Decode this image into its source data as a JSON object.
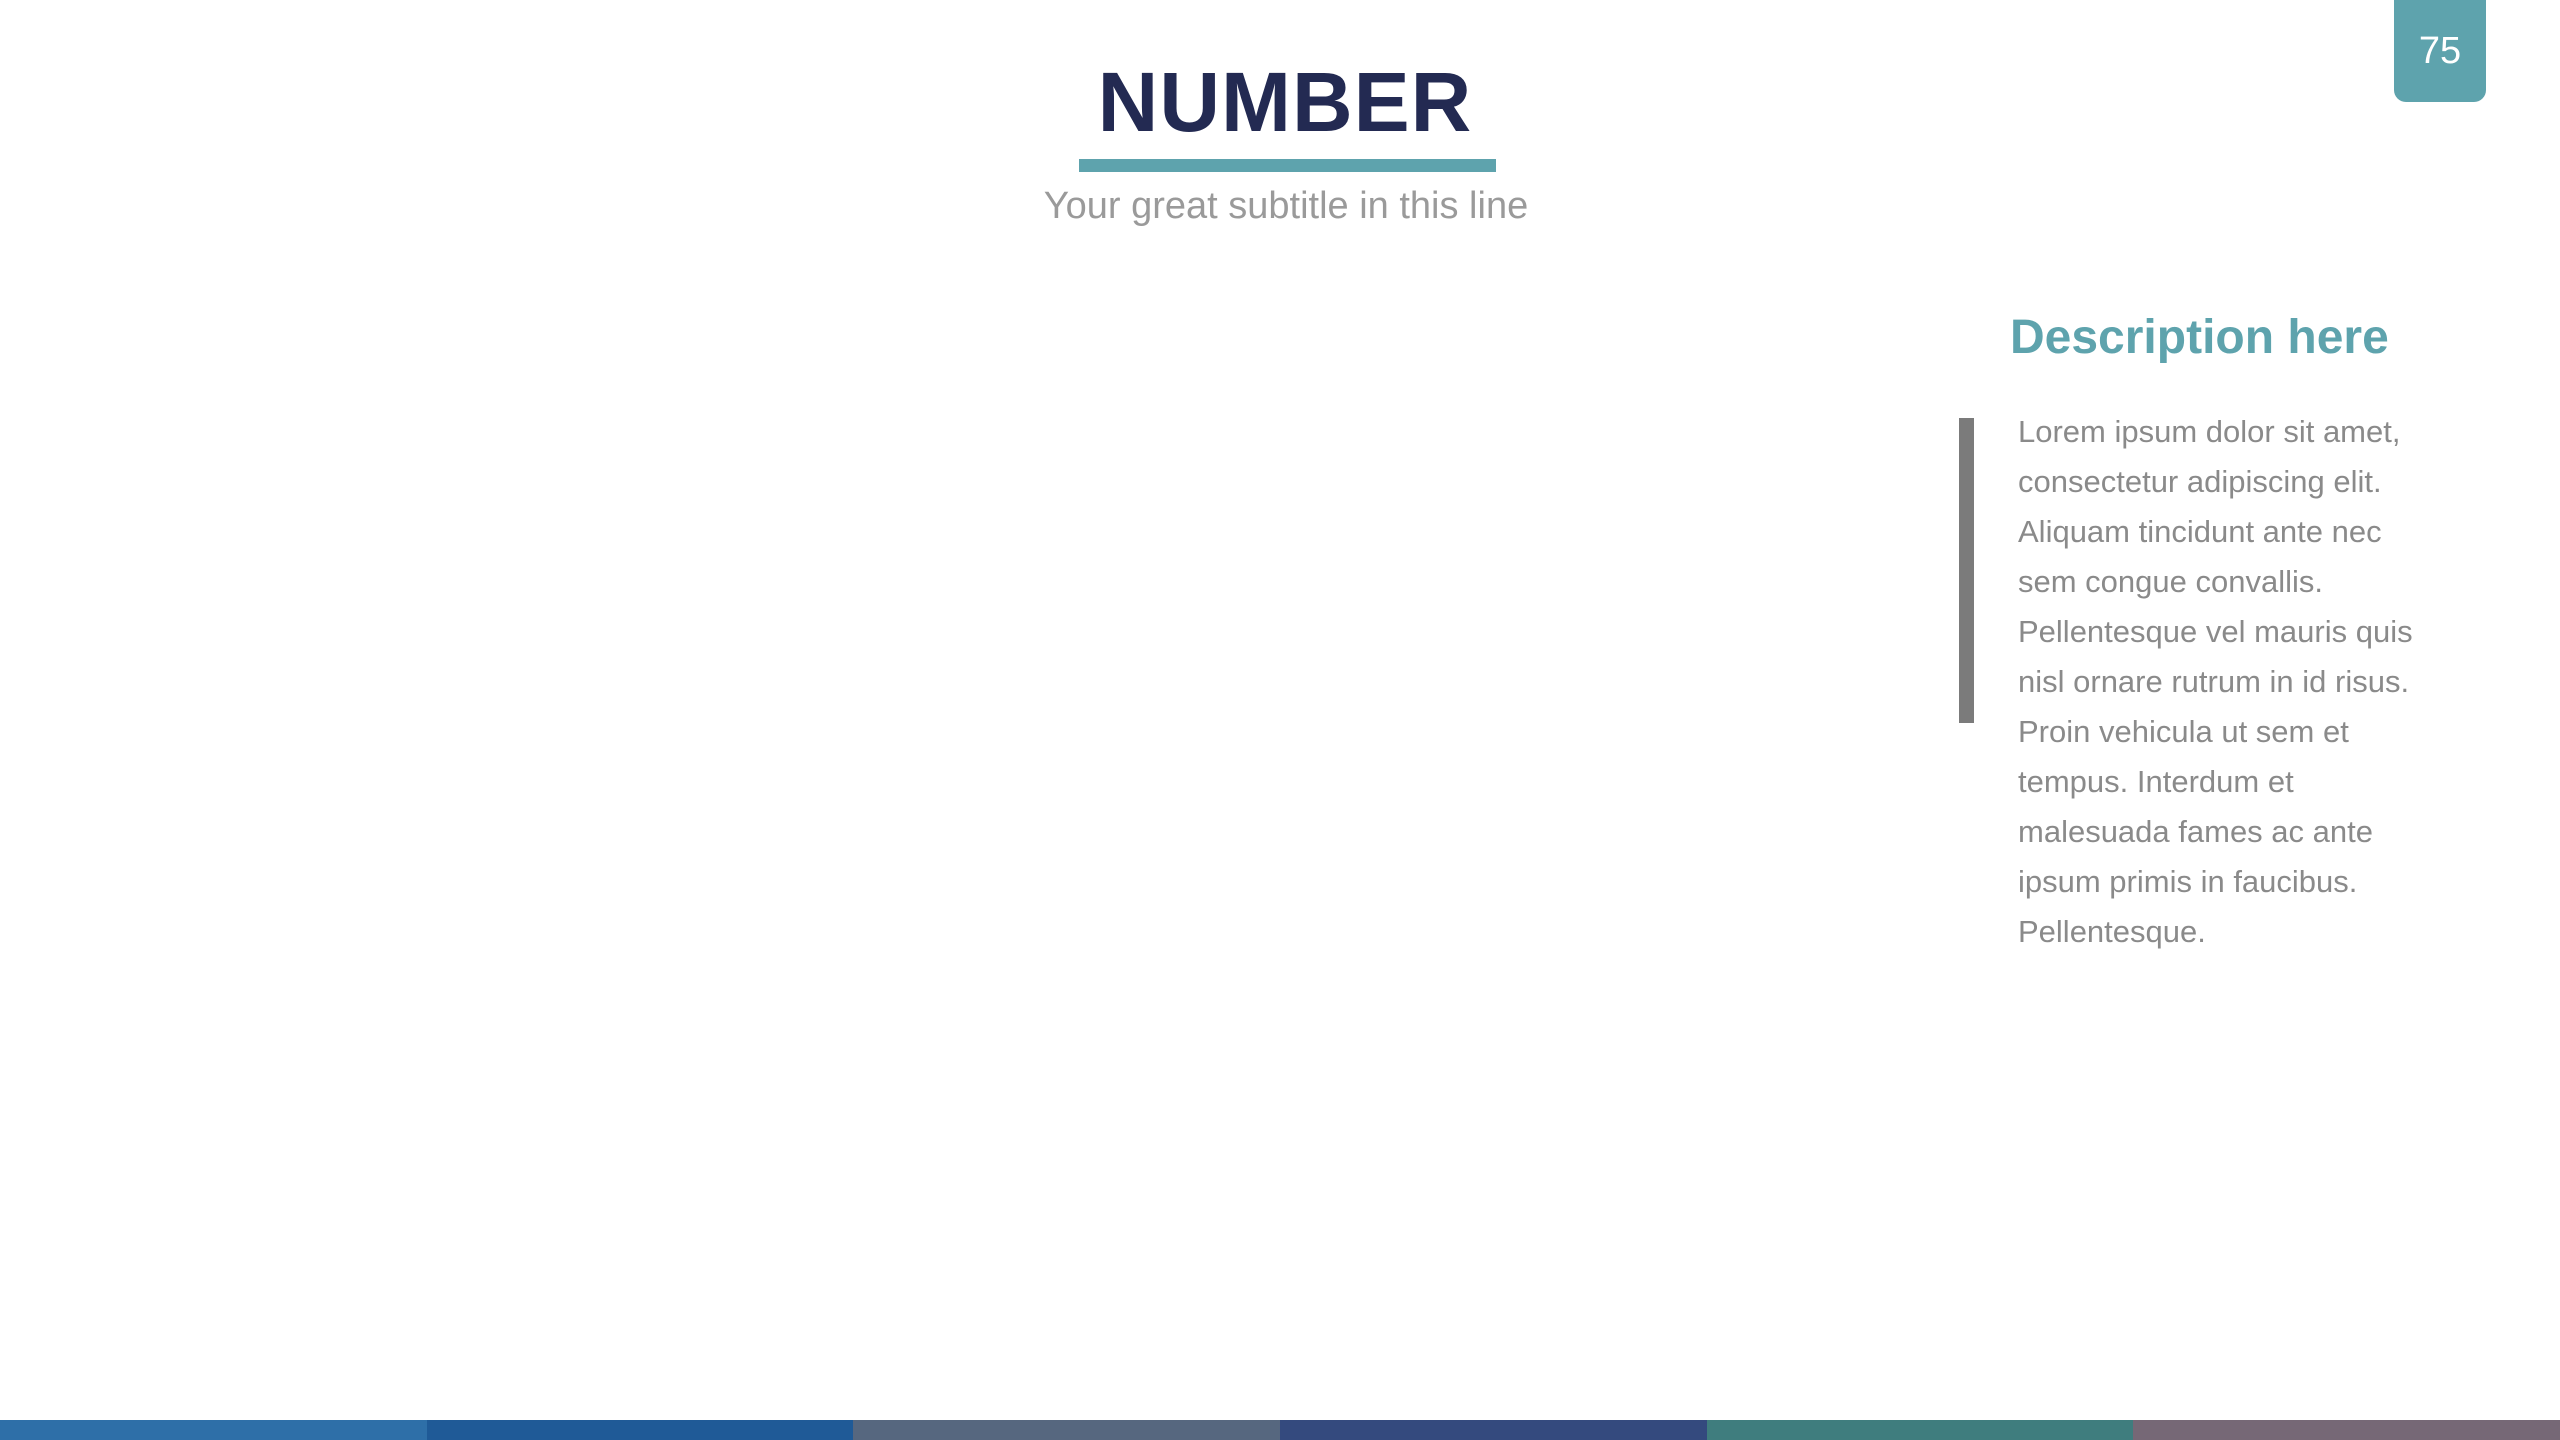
{
  "slide": {
    "page_number": "75",
    "title": "NUMBER",
    "subtitle": "Your great subtitle in this line"
  },
  "description": {
    "heading": "Description here",
    "lines": [
      "Lorem ipsum dolor sit amet,",
      "consectetur adipiscing elit.",
      "Aliquam tincidunt ante nec",
      "sem congue convallis.",
      "Pellentesque vel mauris quis",
      "nisl ornare rutrum in id risus.",
      "Proin vehicula ut sem et",
      "tempus. Interdum et",
      "malesuada fames ac ante",
      "ipsum primis in faucibus.",
      "Pellentesque."
    ]
  },
  "colors": {
    "accent": "#5ea3ad",
    "title": "#232a52",
    "body_text": "#8a8a8a",
    "footer_segments": [
      "#2e6fa8",
      "#1f5a97",
      "#56677f",
      "#344a7e",
      "#3f7d7e",
      "#766876"
    ]
  }
}
